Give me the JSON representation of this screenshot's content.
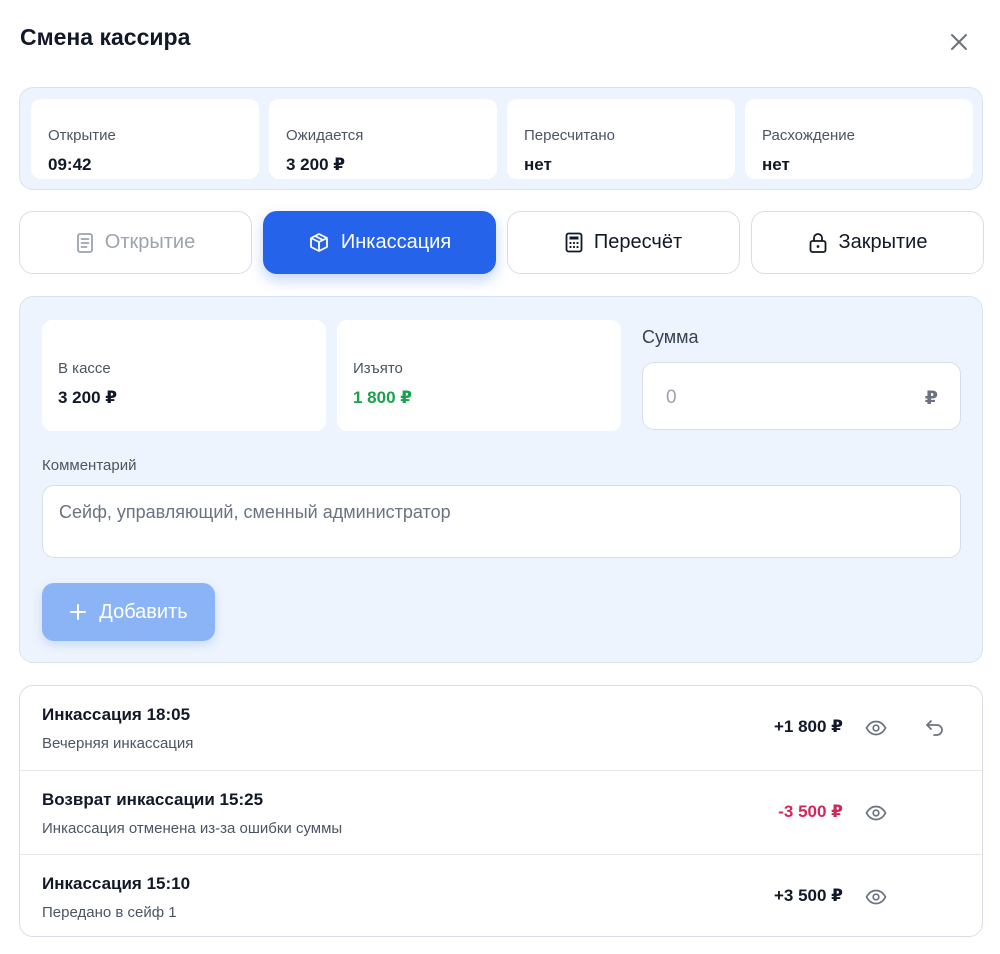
{
  "title": "Смена кассира",
  "stats": [
    {
      "label": "Открытие",
      "value": "09:42"
    },
    {
      "label": "Ожидается",
      "value": "3 200 ₽"
    },
    {
      "label": "Пересчитано",
      "value": "нет"
    },
    {
      "label": "Расхождение",
      "value": "нет"
    }
  ],
  "tabs": [
    {
      "label": "Открытие",
      "icon": "document-icon",
      "state": "disabled"
    },
    {
      "label": "Инкассация",
      "icon": "box-icon",
      "state": "active"
    },
    {
      "label": "Пересчёт",
      "icon": "calculator-icon",
      "state": "normal"
    },
    {
      "label": "Закрытие",
      "icon": "lock-icon",
      "state": "normal"
    }
  ],
  "panel": {
    "in_cash": {
      "label": "В кассе",
      "value": "3 200 ₽"
    },
    "withdrawn": {
      "label": "Изъято",
      "value": "1 800 ₽"
    },
    "sum": {
      "label": "Сумма",
      "placeholder": "0",
      "currency": "₽"
    },
    "comment": {
      "label": "Комментарий",
      "placeholder": "Сейф, управляющий, сменный администратор"
    },
    "add_button": "Добавить"
  },
  "entries": [
    {
      "title": "Инкассация 18:05",
      "subtitle": "Вечерняя инкассация",
      "amount": "+1 800 ₽",
      "negative": false,
      "undo": true
    },
    {
      "title": "Возврат инкассации 15:25",
      "subtitle": "Инкассация отменена из-за ошибки суммы",
      "amount": "-3 500 ₽",
      "negative": true,
      "undo": false
    },
    {
      "title": "Инкассация 15:10",
      "subtitle": "Передано в сейф 1",
      "amount": "+3 500 ₽",
      "negative": false,
      "undo": false
    }
  ],
  "colors": {
    "accent": "#2563eb",
    "positive": "#16a34a",
    "negative": "#d0285a"
  }
}
